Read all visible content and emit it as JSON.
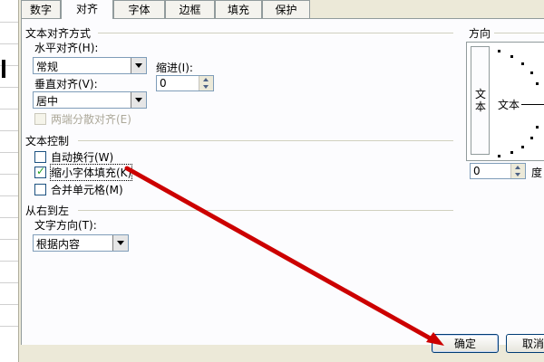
{
  "tabs": [
    "数字",
    "对齐",
    "字体",
    "边框",
    "填充",
    "保护"
  ],
  "active_tab": "对齐",
  "text_alignment": {
    "heading": "文本对齐方式",
    "horizontal_label": "水平对齐(H):",
    "horizontal_value": "常规",
    "indent_label": "缩进(I):",
    "indent_value": "0",
    "vertical_label": "垂直对齐(V):",
    "vertical_value": "居中",
    "justify_distributed_label": "两端分散对齐(E)"
  },
  "text_control": {
    "heading": "文本控制",
    "wrap_text_label": "自动换行(W)",
    "wrap_text_checked": false,
    "shrink_to_fit_label": "缩小字体填充(K)",
    "shrink_to_fit_checked": true,
    "merge_cells_label": "合并单元格(M)",
    "merge_cells_checked": false
  },
  "right_to_left": {
    "heading": "从右到左",
    "direction_label": "文字方向(T):",
    "direction_value": "根据内容"
  },
  "orientation": {
    "heading": "方向",
    "vertical_text": "文本",
    "text_sample": "文本",
    "degrees_value": "0",
    "degrees_unit": "度"
  },
  "buttons": {
    "ok": "确定",
    "cancel": "取消"
  },
  "colors": {
    "dialog_bg": "#ece9d8",
    "panel_bg": "#fcfcfe",
    "annotation_arrow": "#cc0000"
  }
}
